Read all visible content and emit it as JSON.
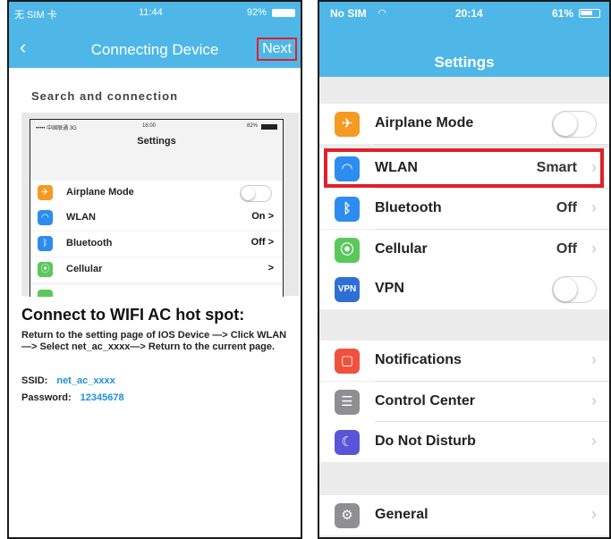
{
  "left_phone": {
    "status": {
      "carrier": "无 SIM 卡",
      "time": "11:44",
      "battery": "92%"
    },
    "nav": {
      "back_glyph": "‹",
      "title": "Connecting Device",
      "next_label": "Next"
    },
    "section_title": "Search and connection",
    "mini_screenshot": {
      "status": {
        "carrier": "••••• 中国联通  3G",
        "time": "16:00",
        "battery": "82%"
      },
      "title": "Settings",
      "rows": [
        {
          "label": "Airplane Mode",
          "value": "",
          "icon": "airplane-icon",
          "color": "#f59a23"
        },
        {
          "label": "WLAN",
          "value": "On  >",
          "icon": "wifi-icon",
          "color": "#2d8cf0"
        },
        {
          "label": "Bluetooth",
          "value": "Off  >",
          "icon": "bluetooth-icon",
          "color": "#2d8cf0"
        },
        {
          "label": "Cellular",
          "value": ">",
          "icon": "cellular-icon",
          "color": "#5ac85a"
        }
      ]
    },
    "heading": "Connect to WIFI AC hot spot:",
    "instructions": "Return to the setting page of IOS Device —> Click WLAN—> Select net_ac_xxxx—> Return to the current page.",
    "ssid_label": "SSID:",
    "ssid_value": "net_ac_xxxx",
    "password_label": "Password:",
    "password_value": "12345678"
  },
  "right_phone": {
    "status": {
      "carrier": "No SIM",
      "time": "20:14",
      "battery": "61%"
    },
    "title": "Settings",
    "rows": [
      {
        "label": "Airplane Mode",
        "value": "",
        "icon": "airplane-icon",
        "color": "#f59a23"
      },
      {
        "label": "WLAN",
        "value": "Smart",
        "icon": "wifi-icon",
        "color": "#2d8cf0"
      },
      {
        "label": "Bluetooth",
        "value": "Off",
        "icon": "bluetooth-icon",
        "color": "#2d8cf0"
      },
      {
        "label": "Cellular",
        "value": "Off",
        "icon": "cellular-icon",
        "color": "#5ac85a"
      },
      {
        "label": "VPN",
        "value": "",
        "icon": "vpn-icon",
        "color": "#2d6fd6"
      },
      {
        "label": "Notifications",
        "value": "",
        "icon": "notifications-icon",
        "color": "#f0503c"
      },
      {
        "label": "Control Center",
        "value": "",
        "icon": "control-center-icon",
        "color": "#8e8e93"
      },
      {
        "label": "Do Not Disturb",
        "value": "",
        "icon": "moon-icon",
        "color": "#5856d6"
      },
      {
        "label": "General",
        "value": "",
        "icon": "gear-icon",
        "color": "#8e8e93"
      }
    ]
  },
  "colors": {
    "header_blue": "#4fb7e8",
    "highlight_red": "#e0202a",
    "link_blue": "#1e90d8"
  }
}
